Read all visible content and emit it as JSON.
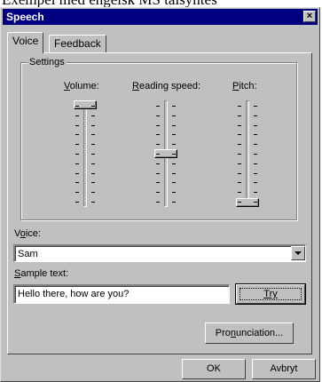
{
  "background_text": "Exempel med engelsk MS talsyntes",
  "window": {
    "title": "Speech",
    "close_glyph": "×"
  },
  "tabs": [
    {
      "label": "Voice",
      "active": true
    },
    {
      "label": "Feedback",
      "active": false
    }
  ],
  "settings": {
    "group_label": "Settings",
    "sliders": [
      {
        "label_prefix": "",
        "mnemonic": "V",
        "label_rest": "olume:",
        "level": 1.0
      },
      {
        "label_prefix": "",
        "mnemonic": "R",
        "label_rest": "eading speed:",
        "level": 0.5
      },
      {
        "label_prefix": "",
        "mnemonic": "P",
        "label_rest": "itch:",
        "level": 0.0
      }
    ]
  },
  "voice": {
    "label_prefix": "V",
    "mnemonic": "o",
    "label_rest": "ice:",
    "selected": "Sam",
    "dropdown_icon": "triangle-down"
  },
  "sample": {
    "label_prefix": "",
    "mnemonic": "S",
    "label_rest": "ample text:",
    "value": "Hello there, how are you?",
    "try_mnemonic": "T",
    "try_rest": "ry"
  },
  "pronunciation": {
    "prefix": "Pro",
    "mnemonic": "n",
    "rest": "unciation..."
  },
  "footer": {
    "ok_label": "OK",
    "cancel_label": "Avbryt"
  }
}
